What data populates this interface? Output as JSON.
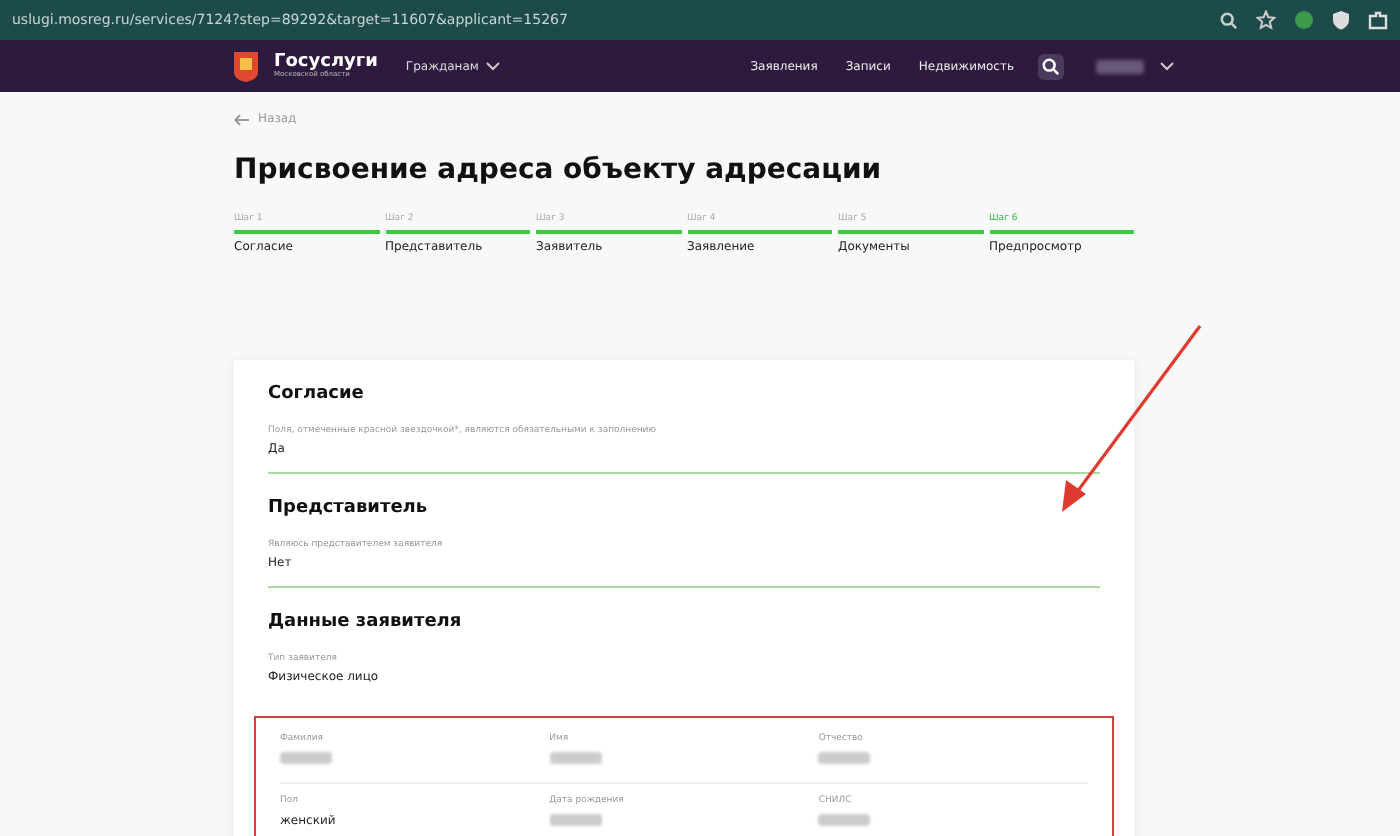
{
  "browser": {
    "url": "uslugi.mosreg.ru/services/7124?step=89292&target=11607&applicant=15267"
  },
  "header": {
    "logo_title": "Госуслуги",
    "logo_subtitle": "Московской области",
    "audience": "Гражданам",
    "nav": [
      "Заявления",
      "Записи",
      "Недвижимость"
    ]
  },
  "back": "Назад",
  "title": "Присвоение адреса объекту адресации",
  "steps": [
    {
      "label": "Шаг 1",
      "name": "Согласие",
      "selected": false
    },
    {
      "label": "Шаг 2",
      "name": "Представитель",
      "selected": false
    },
    {
      "label": "Шаг 3",
      "name": "Заявитель",
      "selected": false
    },
    {
      "label": "Шаг 4",
      "name": "Заявление",
      "selected": false
    },
    {
      "label": "Шаг 5",
      "name": "Документы",
      "selected": false
    },
    {
      "label": "Шаг 6",
      "name": "Предпросмотр",
      "selected": true
    }
  ],
  "sections": [
    {
      "title": "Согласие",
      "fields": [
        {
          "label": "Поля, отмеченные красной звездочкой*, являются обязательными к заполнению",
          "value": "Да"
        }
      ]
    },
    {
      "title": "Представитель",
      "fields": [
        {
          "label": "Являюсь представителем заявителя",
          "value": "Нет"
        }
      ]
    },
    {
      "title": "Данные заявителя",
      "fields": [
        {
          "label": "Тип заявителя",
          "value": "Физическое лицо"
        }
      ]
    }
  ],
  "applicant_grid": [
    {
      "label": "Фамилия",
      "hidden": true
    },
    {
      "label": "Имя",
      "hidden": true
    },
    {
      "label": "Отчество",
      "hidden": true
    },
    {
      "label": "Пол",
      "value": "женский",
      "hidden": false
    },
    {
      "label": "Дата рождения",
      "hidden": true
    },
    {
      "label": "СНИЛС",
      "hidden": true
    }
  ]
}
